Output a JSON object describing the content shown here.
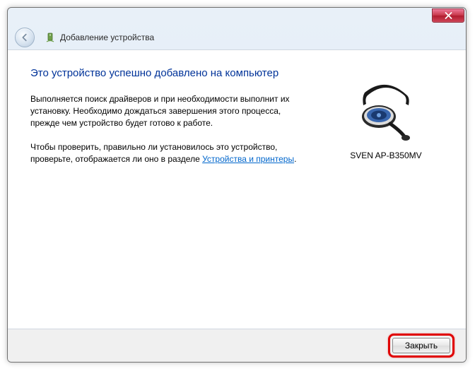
{
  "window": {
    "wizard_title": "Добавление устройства"
  },
  "content": {
    "heading": "Это устройство успешно добавлено на компьютер",
    "paragraph1": "Выполняется поиск драйверов и при необходимости выполнит их установку. Необходимо дождаться завершения этого процесса, прежде чем устройство будет готово к работе.",
    "paragraph2_pre": "Чтобы проверить, правильно ли установилось это устройство, проверьте, отображается ли оно в разделе ",
    "paragraph2_link": "Устройства и принтеры",
    "paragraph2_post": "."
  },
  "device": {
    "name": "SVEN AP-B350MV"
  },
  "footer": {
    "close_label": "Закрыть"
  }
}
